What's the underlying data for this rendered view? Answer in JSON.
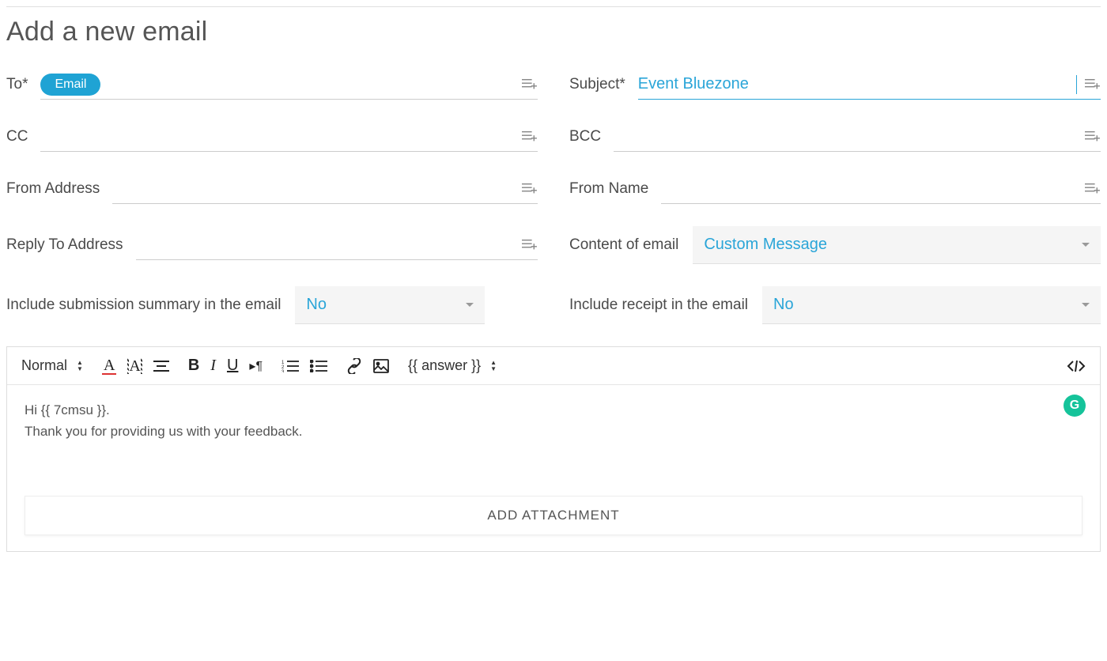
{
  "page_title": "Add a new email",
  "fields": {
    "to": {
      "label": "To*",
      "chip": "Email"
    },
    "subject": {
      "label": "Subject*",
      "value": "Event Bluezone"
    },
    "cc": {
      "label": "CC"
    },
    "bcc": {
      "label": "BCC"
    },
    "from_address": {
      "label": "From Address"
    },
    "from_name": {
      "label": "From Name"
    },
    "reply_to": {
      "label": "Reply To Address"
    },
    "content_of_email": {
      "label": "Content of email",
      "value": "Custom Message"
    },
    "include_summary": {
      "label": "Include submission summary in the email",
      "value": "No"
    },
    "include_receipt": {
      "label": "Include receipt in the email",
      "value": "No"
    }
  },
  "toolbar": {
    "format": "Normal",
    "answer_token": "{{ answer }}"
  },
  "editor": {
    "line1": "Hi {{ 7cmsu }}.",
    "line2": "Thank you for providing us with your feedback."
  },
  "attach_label": "ADD ATTACHMENT",
  "grammarly_label": "G"
}
